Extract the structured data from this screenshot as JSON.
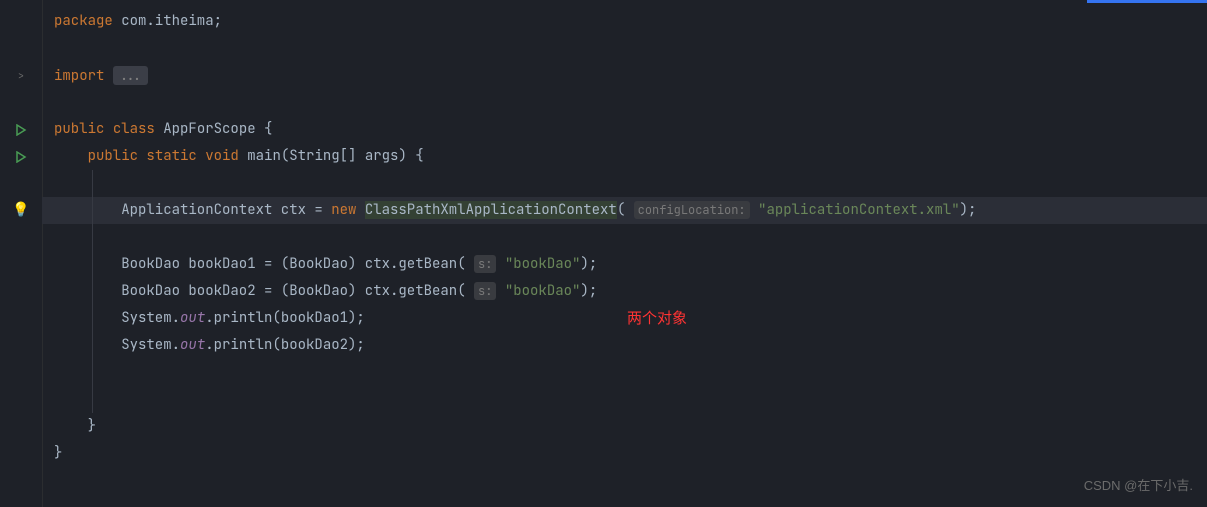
{
  "code": {
    "line1_kw_package": "package",
    "line1_pkg": " com.itheima;",
    "line3_kw_import": "import",
    "line3_folded": "...",
    "line5_kw_public": "public",
    "line5_kw_class": "class",
    "line5_classname": "AppForScope",
    "line5_brace": " {",
    "line6_kw_public": "public",
    "line6_kw_static": "static",
    "line6_kw_void": "void",
    "line6_method": "main",
    "line6_params": "(String[] args) {",
    "line8_type": "ApplicationContext ctx = ",
    "line8_kw_new": "new",
    "line8_class": "ClassPathXmlApplicationContext",
    "line8_hint": "configLocation:",
    "line8_str": "\"applicationContext.xml\"",
    "line8_end": ");",
    "line10_a": "BookDao bookDao1 = (BookDao) ctx.getBean(",
    "line10_hint": "s:",
    "line10_str": "\"bookDao\"",
    "line10_end": ");",
    "line11_a": "BookDao bookDao2 = (BookDao) ctx.getBean(",
    "line11_hint": "s:",
    "line11_str": "\"bookDao\"",
    "line11_end": ");",
    "line12_a": "System.",
    "line12_out": "out",
    "line12_b": ".println(bookDao1);",
    "line13_a": "System.",
    "line13_out": "out",
    "line13_b": ".println(bookDao2);",
    "line16_brace": "}",
    "line17_brace": "}"
  },
  "annotation": "两个对象",
  "watermark": "CSDN @在下小吉."
}
